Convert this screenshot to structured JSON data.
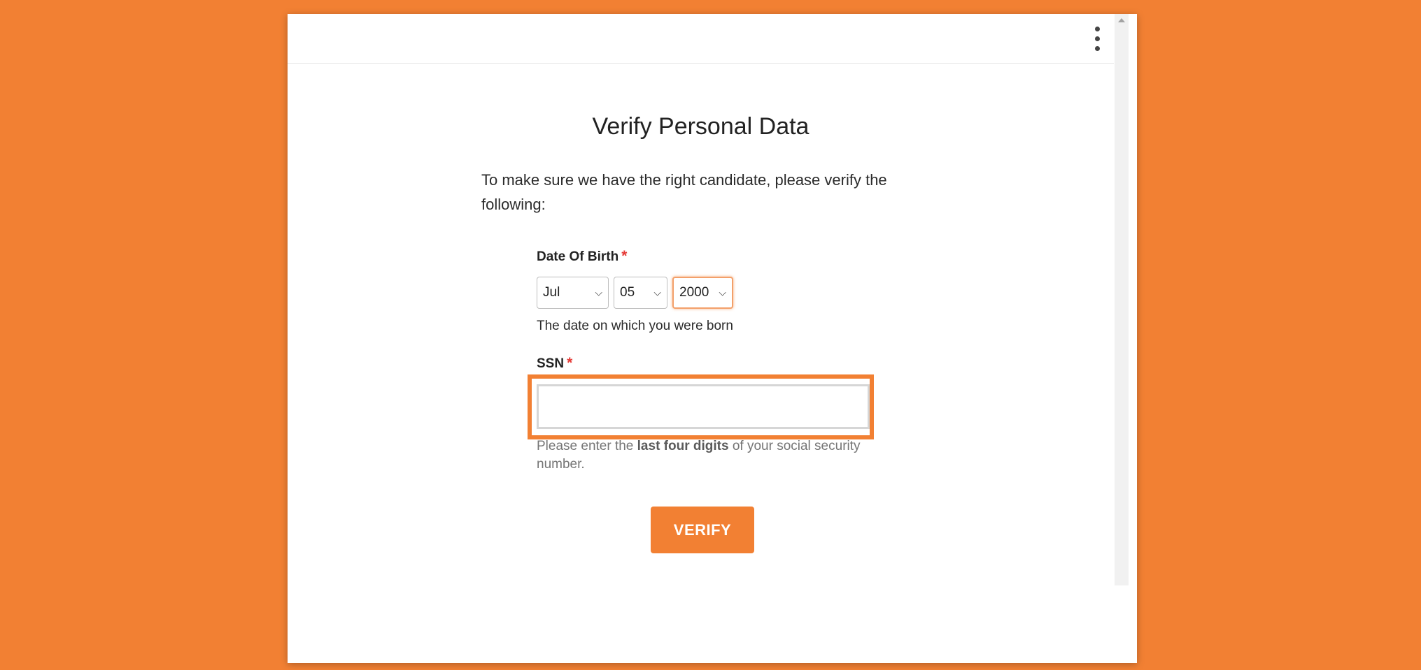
{
  "page": {
    "title": "Verify Personal Data",
    "intro": "To make sure we have the right candidate, please verify the following:"
  },
  "dob": {
    "label": "Date Of Birth",
    "required_mark": "*",
    "month": "Jul",
    "day": "05",
    "year": "2000",
    "hint": "The date on which you were born"
  },
  "ssn": {
    "label": "SSN",
    "required_mark": "*",
    "value": "",
    "hint_prefix": "Please enter the ",
    "hint_bold": "last four digits",
    "hint_suffix": " of your social security number."
  },
  "actions": {
    "verify_label": "VERIFY"
  },
  "icons": {
    "menu": "kebab-menu-icon",
    "dropdown": "chevron-down-icon",
    "scroll_up": "scroll-up-arrow-icon"
  },
  "colors": {
    "background": "#f28033",
    "accent": "#f28033",
    "required": "#e53935"
  }
}
